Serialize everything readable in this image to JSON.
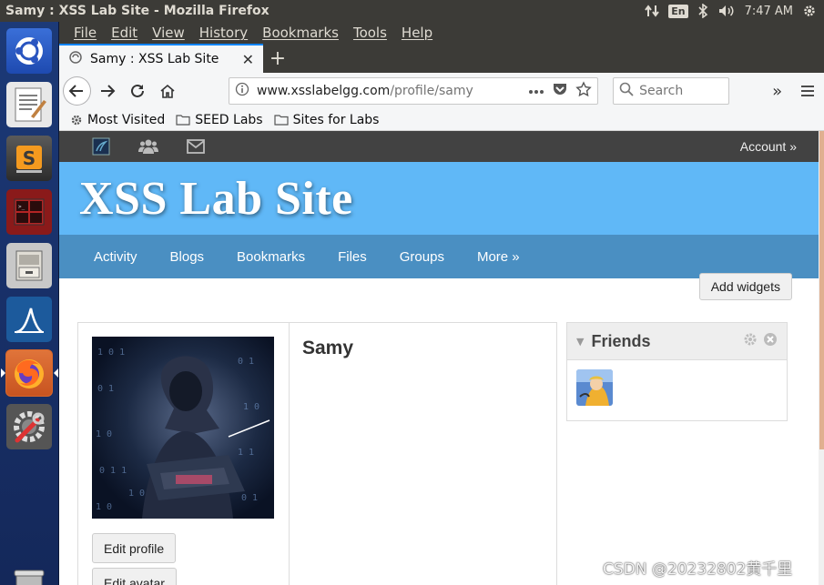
{
  "os": {
    "window_title": "Samy : XSS Lab Site - Mozilla Firefox",
    "keyboard_layout": "En",
    "clock": "7:47 AM"
  },
  "launcher": {
    "items": [
      {
        "name": "ubuntu-dash"
      },
      {
        "name": "text-editor"
      },
      {
        "name": "sublime-text"
      },
      {
        "name": "terminal"
      },
      {
        "name": "file-manager"
      },
      {
        "name": "wireshark"
      },
      {
        "name": "firefox"
      },
      {
        "name": "system-settings"
      },
      {
        "name": "trash"
      }
    ]
  },
  "browser": {
    "menus": [
      "File",
      "Edit",
      "View",
      "History",
      "Bookmarks",
      "Tools",
      "Help"
    ],
    "tab": {
      "title": "Samy : XSS Lab Site"
    },
    "url": {
      "host": "www.xsslabelgg.com",
      "path": "/profile/samy"
    },
    "search_placeholder": "Search",
    "bookmarks": [
      "Most Visited",
      "SEED Labs",
      "Sites for Labs"
    ]
  },
  "site": {
    "account_label": "Account »",
    "title": "XSS Lab Site",
    "nav": [
      "Activity",
      "Blogs",
      "Bookmarks",
      "Files",
      "Groups",
      "More »"
    ],
    "add_widgets_label": "Add widgets",
    "profile": {
      "name": "Samy",
      "edit_profile_label": "Edit profile",
      "edit_avatar_label": "Edit avatar"
    },
    "friends": {
      "title": "Friends"
    }
  },
  "watermark": "CSDN @20232802黄千里",
  "colors": {
    "accent": "#0a84ff",
    "header_bg": "#60b8f7",
    "nav_bg": "#4a8fc2",
    "topbar_bg": "#424242"
  }
}
